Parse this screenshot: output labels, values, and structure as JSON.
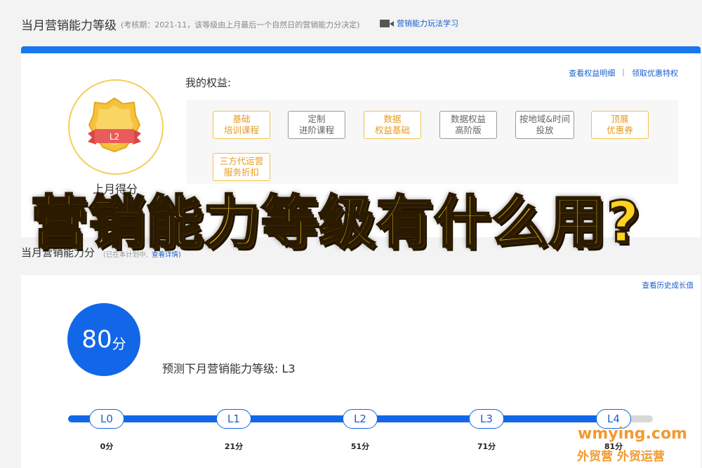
{
  "header": {
    "title": "当月营销能力等级",
    "note": "(考核期：2021-11，该等级由上月最后一个自然日的营销能力分决定)",
    "video_link": "营销能力玩法学习",
    "video_icon": "video-camera-icon"
  },
  "benefits_card": {
    "accent_color": "#1677f0",
    "links": {
      "detail": "查看权益明细",
      "separator": "|",
      "claim": "领取优惠特权"
    },
    "current_level": "L2",
    "label": "我的权益:",
    "items": [
      {
        "text": "基础\n培训课程",
        "style": "gold"
      },
      {
        "text": "定制\n进阶课程",
        "style": "grey"
      },
      {
        "text": "数据\n权益基础",
        "style": "gold"
      },
      {
        "text": "数据权益\n高阶版",
        "style": "grey"
      },
      {
        "text": "按地域&时间\n投放",
        "style": "grey"
      },
      {
        "text": "顶展\n优惠券",
        "style": "gold"
      },
      {
        "text": "三方代运营\n服务折扣",
        "style": "gold"
      }
    ],
    "last_month_label": "上月得分"
  },
  "overlay_title": "营销能力等级有什么用?",
  "score_section": {
    "title": "当月营销能力分",
    "note": "(已在本计划中,",
    "detail_link": "查看详情)",
    "history_link": "查看历史成长值",
    "score": "80",
    "score_unit": "分",
    "prediction": "预测下月营销能力等级: L3",
    "progress_fraction": 0.96,
    "levels": [
      {
        "label": "L0",
        "score": "0分"
      },
      {
        "label": "L1",
        "score": "21分"
      },
      {
        "label": "L2",
        "score": "51分"
      },
      {
        "label": "L3",
        "score": "71分"
      },
      {
        "label": "L4",
        "score": "81分"
      }
    ]
  },
  "watermark": {
    "domain": "wmying.com",
    "text": "外贸营 外贸运营"
  }
}
